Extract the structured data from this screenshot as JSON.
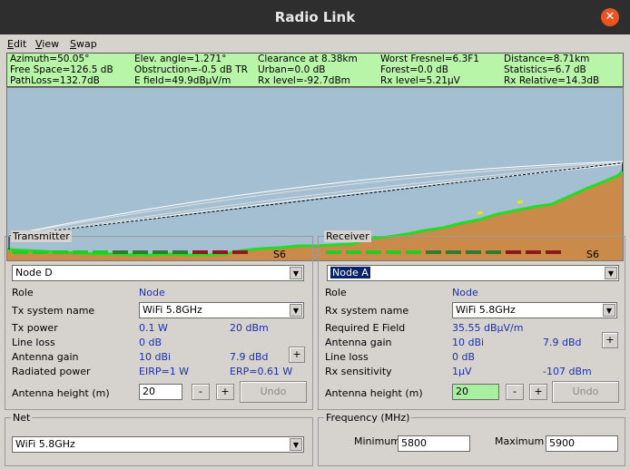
{
  "window": {
    "title": "Radio Link",
    "close_icon": "close-icon"
  },
  "menu": [
    {
      "label": "Edit",
      "underline": "E",
      "rest": "dit"
    },
    {
      "label": "View",
      "underline": "V",
      "rest": "iew"
    },
    {
      "label": "Swap",
      "underline": "S",
      "rest": "wap"
    }
  ],
  "stats": {
    "rows": [
      [
        "Azimuth=50.05°",
        "Elev. angle=1.271°",
        "Clearance at 8.38km",
        "Worst Fresnel=6.3F1",
        "Distance=8.71km"
      ],
      [
        "Free Space=126.5 dB",
        "Obstruction=-0.5 dB TR",
        "Urban=0.0 dB",
        "Forest=0.0 dB",
        "Statistics=6.7 dB"
      ],
      [
        "PathLoss=132.7dB",
        "E field=49.9dBµV/m",
        "Rx level=-92.7dBm",
        "Rx level=5.21µV",
        "Rx Relative=14.3dB"
      ]
    ],
    "colors": {
      "background": "#b8f5a8"
    }
  },
  "profile": {
    "colors": {
      "sky": "#a4bfd2",
      "terrain": "#c98a4a",
      "terrain_top": "#22dd22",
      "fresnel": "#ffffff",
      "los": "#000000",
      "highlight": "#e8e800"
    }
  },
  "transmitter": {
    "title": "Transmitter",
    "meter_label": "S6",
    "meter_levels": [
      "green",
      "green",
      "green",
      "green",
      "green",
      "dgreen",
      "dgreen",
      "dgreen",
      "dgreen",
      "red",
      "red",
      "red"
    ],
    "node": "Node D",
    "role_label": "Role",
    "role_value": "Node",
    "system_label": "Tx system name",
    "system_value": "WiFi 5.8GHz",
    "power_label": "Tx power",
    "power_w": "0.1 W",
    "power_dbm": "20 dBm",
    "lineloss_label": "Line loss",
    "lineloss_value": "0 dB",
    "gain_label": "Antenna gain",
    "gain_dbi": "10 dBi",
    "gain_dbd": "7.9 dBd",
    "radiated_label": "Radiated power",
    "eirp": "EIRP=1 W",
    "erp": "ERP=0.61 W",
    "height_label": "Antenna height (m)",
    "height_value": "20",
    "minus": "-",
    "plus": "+",
    "undo": "Undo"
  },
  "receiver": {
    "title": "Receiver",
    "meter_label": "S6",
    "meter_levels": [
      "green",
      "green",
      "green",
      "green",
      "green",
      "dgreen",
      "dgreen",
      "dgreen",
      "dgreen",
      "red",
      "red",
      "red"
    ],
    "node": "Node A",
    "role_label": "Role",
    "role_value": "Node",
    "system_label": "Rx system name",
    "system_value": "WiFi 5.8GHz",
    "efield_label": "Required E Field",
    "efield_value": "35.55 dBµV/m",
    "gain_label": "Antenna gain",
    "gain_dbi": "10 dBi",
    "gain_dbd": "7.9 dBd",
    "lineloss_label": "Line loss",
    "lineloss_value": "0 dB",
    "sens_label": "Rx sensitivity",
    "sens_uv": "1µV",
    "sens_dbm": "-107 dBm",
    "height_label": "Antenna height (m)",
    "height_value": "20",
    "minus": "-",
    "plus": "+",
    "undo": "Undo"
  },
  "net": {
    "title": "Net",
    "value": "WiFi 5.8GHz"
  },
  "frequency": {
    "title": "Frequency (MHz)",
    "min_label": "Minimum",
    "min_value": "5800",
    "max_label": "Maximum",
    "max_value": "5900"
  }
}
